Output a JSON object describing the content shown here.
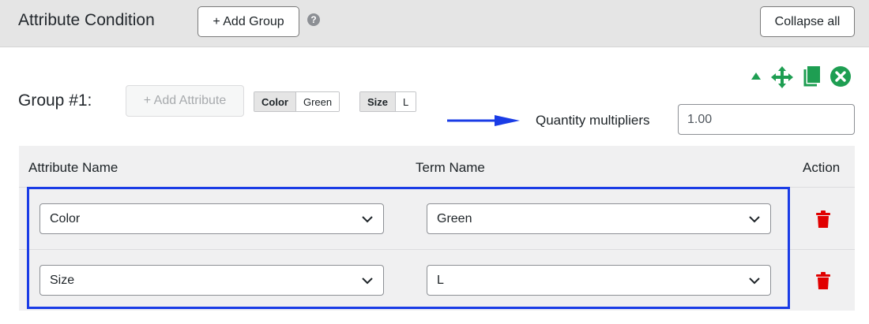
{
  "header": {
    "title": "Attribute Condition",
    "add_group_label": "+ Add Group",
    "help_glyph": "?",
    "collapse_label": "Collapse all"
  },
  "group": {
    "title": "Group #1:",
    "add_attribute_label": "+ Add Attribute",
    "tags": [
      {
        "key": "Color",
        "value": "Green"
      },
      {
        "key": "Size",
        "value": "L"
      }
    ],
    "controls": [
      "triangle-up-icon",
      "move-icon",
      "copy-icon",
      "close-circle-icon"
    ],
    "control_color": "#1e9e52"
  },
  "quantity": {
    "label": "Quantity multipliers",
    "value": "1.00"
  },
  "table": {
    "headers": {
      "attribute": "Attribute Name",
      "term": "Term Name",
      "action": "Action"
    },
    "rows": [
      {
        "attribute": "Color",
        "term": "Green"
      },
      {
        "attribute": "Size",
        "term": "L"
      }
    ],
    "delete_icon_color": "#e10000"
  },
  "annotation": {
    "highlight_color": "#1a3ce6"
  }
}
